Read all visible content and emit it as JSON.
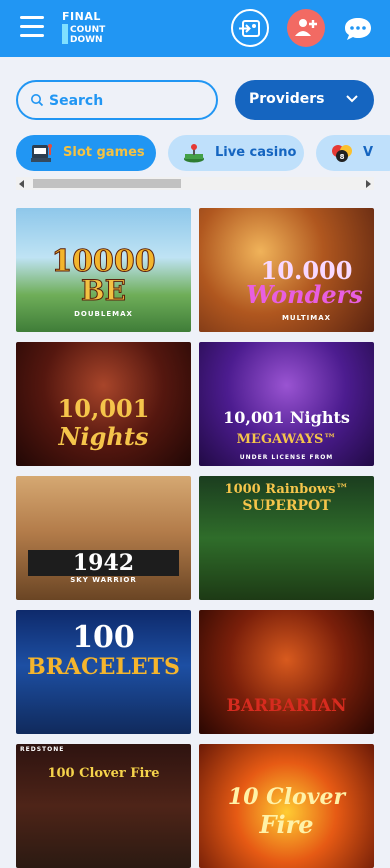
{
  "header": {
    "logo": {
      "line1": "FINAL",
      "line2": "COUNT",
      "line3": "DOWN"
    },
    "login_icon": "login-icon",
    "register_icon": "add-user-icon",
    "chat_icon": "chat-bubble-icon"
  },
  "search": {
    "placeholder": "Search"
  },
  "providers": {
    "label": "Providers"
  },
  "tabs": [
    {
      "label": "Slot games",
      "icon": "slot-machine-icon"
    },
    {
      "label": "Live casino",
      "icon": "joystick-icon"
    },
    {
      "label": "V",
      "icon": "vip-balls-icon"
    }
  ],
  "games": [
    {
      "title": "10000",
      "sub": "BE",
      "tag": "DOUBLEMAX"
    },
    {
      "title": "10.000",
      "sub": "Wonders",
      "tag": "MULTIMAX"
    },
    {
      "title": "10,001",
      "sub": "Nights"
    },
    {
      "title": "10,001 Nights",
      "sub": "MEGAWAYS™",
      "tag": "UNDER LICENSE FROM"
    },
    {
      "title": "1942",
      "sub": "SKY WARRIOR"
    },
    {
      "title": "1000 Rainbows™",
      "sub": "SUPERPOT"
    },
    {
      "title": "100",
      "sub": "BRACELETS"
    },
    {
      "title": "BARBARIAN"
    },
    {
      "title": "100 Clover Fire",
      "tag": "REDSTONE"
    },
    {
      "title": "10 Clover",
      "sub": "Fire"
    }
  ],
  "colors": {
    "primary": "#2196f3",
    "dark_blue": "#1565c0",
    "register": "#f26a63",
    "accent_yellow": "#f5c242"
  }
}
